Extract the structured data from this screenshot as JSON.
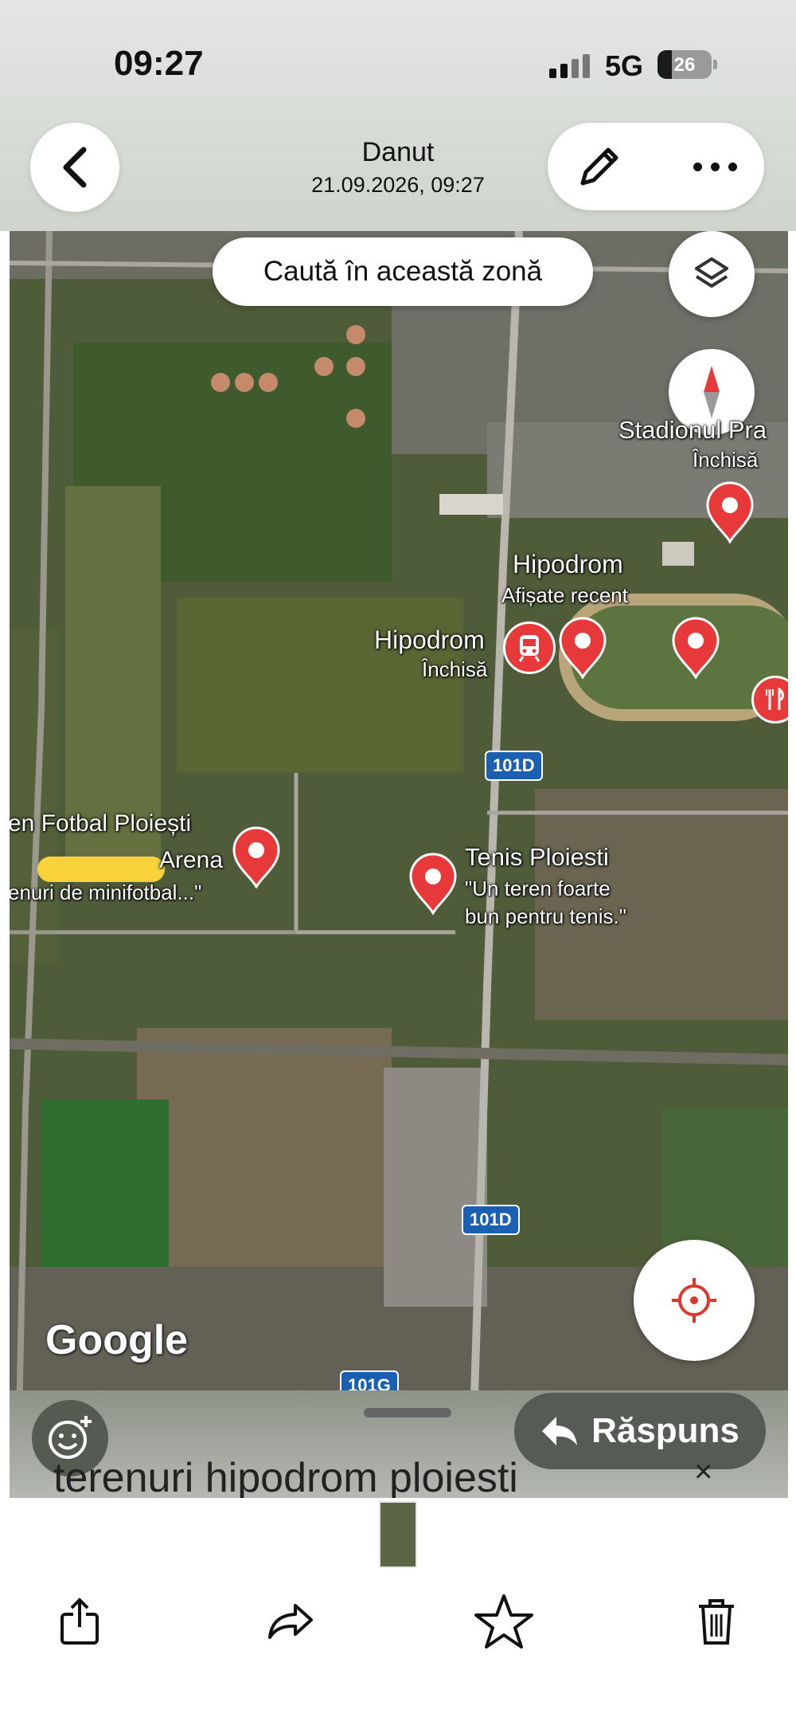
{
  "status_bar": {
    "time": "09:27",
    "network": "5G",
    "battery": "26",
    "battery_level": 0.26
  },
  "header": {
    "sender": "Danut",
    "datetime": "21.09.2026, 09:27",
    "back_icon": "chevron-left-icon",
    "edit_icon": "pencil-icon",
    "more_icon": "ellipsis-icon"
  },
  "map": {
    "search_area_button": "Caută în această zonă",
    "places": [
      {
        "name": "Stadionul Pra",
        "status": "Închisă"
      },
      {
        "name": "Hipodrom",
        "status": "Afișate recent"
      },
      {
        "name": "Hipodrom",
        "status": "Închisă"
      },
      {
        "name": "en Fotbal Ploiești",
        "line2": "Arena",
        "line3": "enuri de minifotbal...\""
      },
      {
        "name": "Tenis Ploiesti",
        "line2": "\"Un teren foarte",
        "line3": "bun pentru tenis.\""
      }
    ],
    "road_labels": [
      "101D",
      "101D",
      "101G"
    ],
    "attribution": "Google",
    "layers_icon": "layers-icon",
    "compass_icon": "compass-icon",
    "locate_icon": "locate-icon",
    "pin_icon": "map-pin-icon",
    "train_icon": "train-icon",
    "restaurant_icon": "restaurant-icon"
  },
  "reply_bar": {
    "reply_label": "Răspuns",
    "search_query": "terenuri hipodrom ploiesti",
    "close_label": "×",
    "emoji_icon": "add-reaction-icon",
    "reply_icon": "reply-arrow-icon"
  },
  "toolbar": {
    "share_icon": "share-icon",
    "forward_icon": "forward-icon",
    "star_icon": "star-icon",
    "delete_icon": "trash-icon"
  },
  "colors": {
    "pin_red": "#e8393a",
    "road_shield": "#1b5fb2",
    "accent_map": "#4d5a39"
  }
}
